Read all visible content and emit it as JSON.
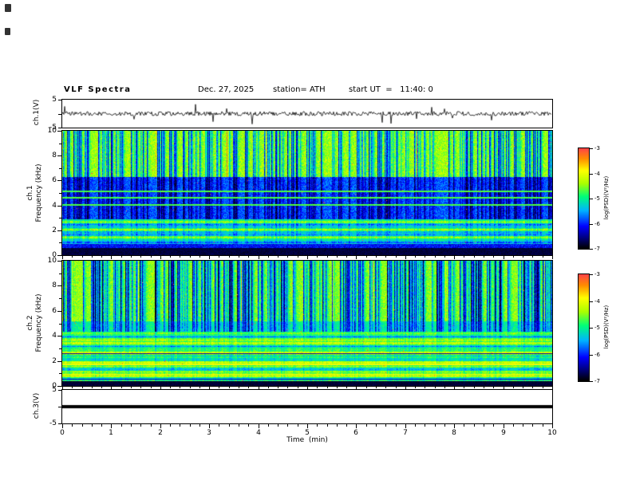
{
  "header": {
    "title": "VLF Spectra",
    "date": "Dec. 27, 2025",
    "station": "station= ATH",
    "start_ut": "start UT  =   11:40: 0"
  },
  "xaxis": {
    "label": "Time  (min)",
    "min": 0,
    "max": 10,
    "major_ticks": [
      0,
      1,
      2,
      3,
      4,
      5,
      6,
      7,
      8,
      9,
      10
    ],
    "minor_tick_step": 0.2
  },
  "colors": {
    "background": "#ffffff",
    "frame": "#000000",
    "trace": "#000000",
    "colormap_stops": [
      "#000000",
      "#000078",
      "#0000ff",
      "#00b4ff",
      "#00ff78",
      "#aaff00",
      "#ffff00",
      "#ff8c00",
      "#ff4646"
    ]
  },
  "chart_data": [
    {
      "id": "ch1_waveform",
      "type": "line",
      "ylabel": "ch.1(V)",
      "ylim": [
        -5,
        5
      ],
      "yticks": [
        5,
        -5
      ],
      "xlim": [
        0,
        10
      ],
      "description": "Broadband VLF receiver output: noisy trace centred on 0 V (~±1 V) with frequent impulsive sferic spikes reaching toward ±5 V across the full 10 min record."
    },
    {
      "id": "ch1_spectrogram",
      "type": "heatmap",
      "ylabel": "ch.1",
      "ylabel2": "Frequency (kHz)",
      "ylim": [
        0,
        10
      ],
      "yticks": [
        0,
        2,
        4,
        6,
        8,
        10
      ],
      "xlim": [
        0,
        10
      ],
      "value_label": "log(PSD)(V²/Hz)",
      "value_range": [
        -7,
        -3
      ],
      "colorbar_ticks": [
        -3,
        -4,
        -5,
        -6,
        -7
      ],
      "features": {
        "black_band_kHz": [
          0,
          0.6
        ],
        "cyan_green_horizontal_bands_kHz": [
          0.9,
          2.9
        ],
        "dark_blue_region_kHz": [
          2.9,
          6.3
        ],
        "green_yellow_region_kHz": [
          6.3,
          10
        ],
        "narrow_cyan_lines_kHz": [
          4.05,
          4.65,
          5.15
        ],
        "vertical_streaks": "dense impulsive sferic streaks (dark blue) through 3-10 kHz with occasional bright yellow columns and sparse red specks"
      }
    },
    {
      "id": "ch2_spectrogram",
      "type": "heatmap",
      "ylabel": "ch.2",
      "ylabel2": "Frequency (kHz)",
      "ylim": [
        0,
        10
      ],
      "yticks": [
        0,
        2,
        4,
        6,
        8,
        10
      ],
      "xlim": [
        0,
        10
      ],
      "value_label": "log(PSD)(V²/Hz)",
      "value_range": [
        -7,
        -3
      ],
      "colorbar_ticks": [
        -3,
        -4,
        -5,
        -6,
        -7
      ],
      "features": {
        "black_band_kHz": [
          0,
          0.4
        ],
        "green_cyan_banded_region_kHz": [
          0.4,
          4.3
        ],
        "yellow_orange_lines_kHz": [
          0.95,
          1.75
        ],
        "dark_lines_kHz": [
          0.55,
          2.6
        ],
        "streaky_blue_green_region_kHz": [
          4.3,
          10
        ],
        "vertical_streaks": "strong dark-blue sferic streaks through 4-10 kHz, denser than ch.1"
      }
    },
    {
      "id": "ch3_waveform",
      "type": "line",
      "ylabel": "ch.3(V)",
      "ylim": [
        -5,
        5
      ],
      "yticks": [
        5,
        -5
      ],
      "xlim": [
        0,
        10
      ],
      "description": "Flat heavy black trace at 0 V for the whole record (channel inactive)."
    }
  ]
}
